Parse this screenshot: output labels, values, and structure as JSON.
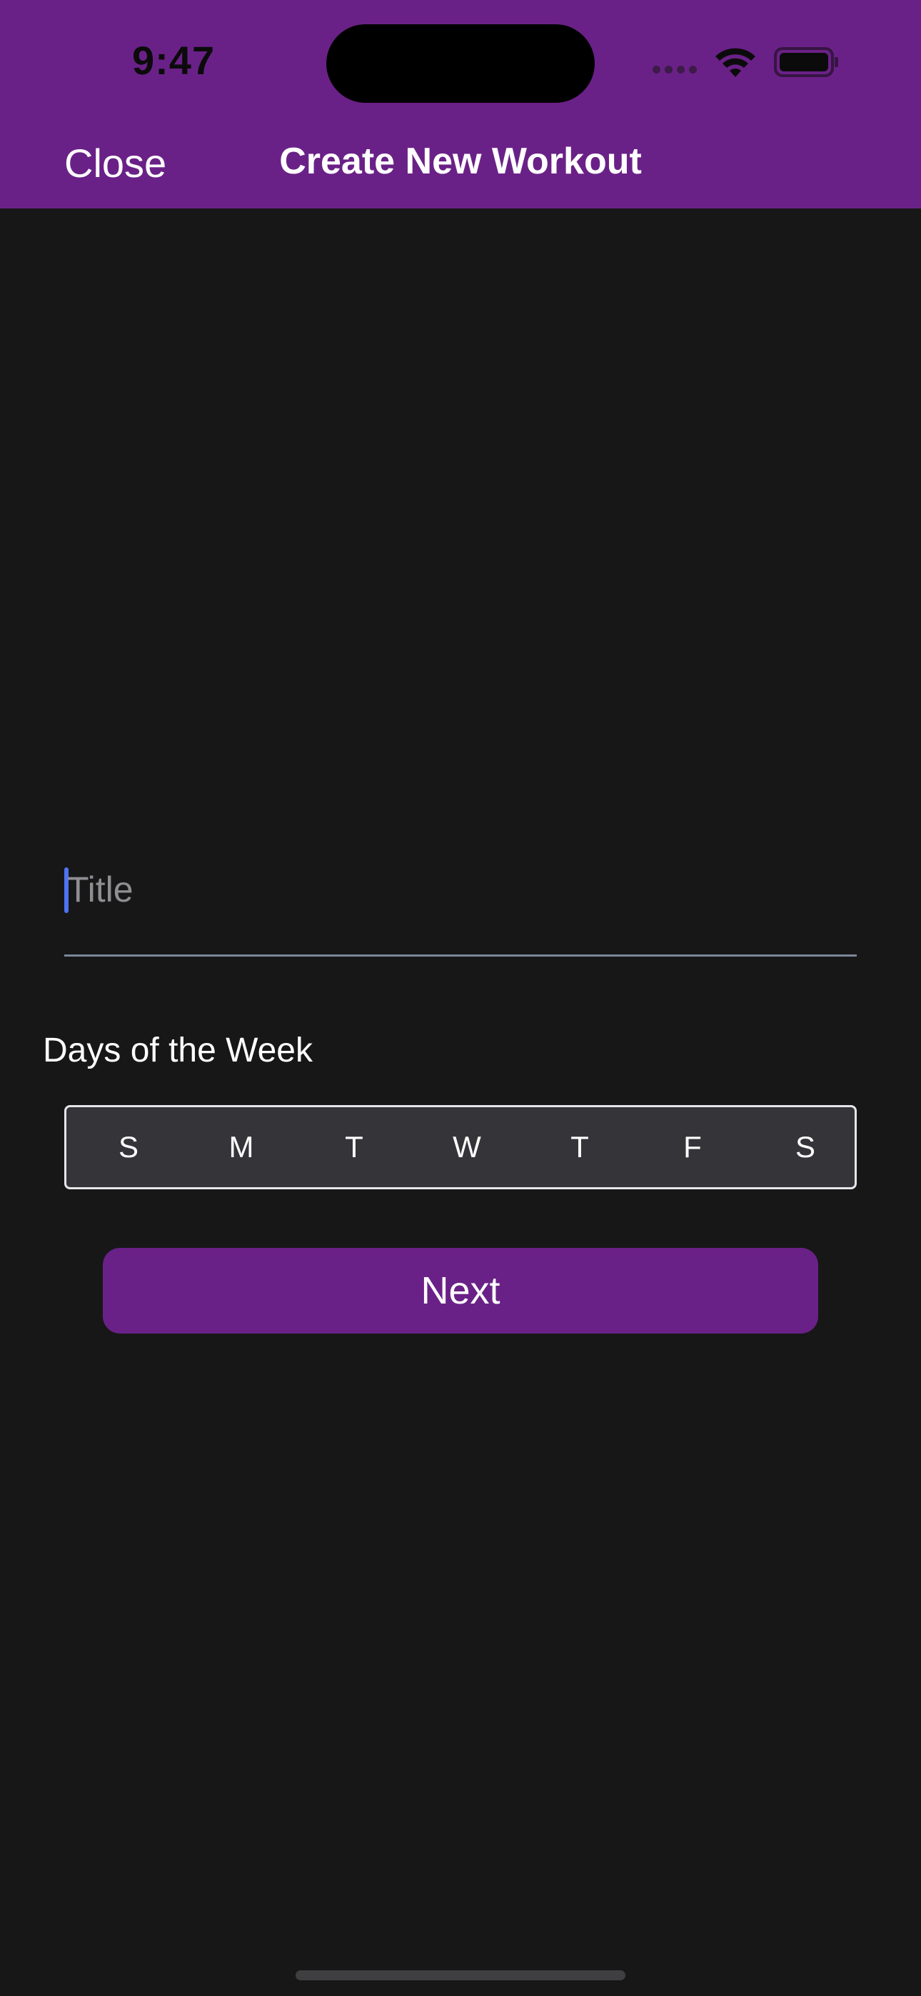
{
  "status_bar": {
    "time": "9:47"
  },
  "nav": {
    "close_label": "Close",
    "title": "Create New Workout"
  },
  "form": {
    "title_placeholder": "Title",
    "title_value": "",
    "days_label": "Days of the Week",
    "days": [
      "S",
      "M",
      "T",
      "W",
      "T",
      "F",
      "S"
    ],
    "next_label": "Next"
  },
  "colors": {
    "accent": "#6a2187",
    "background": "#171717",
    "segment_bg": "#353539",
    "cursor": "#4d73f2"
  },
  "icons": {
    "wifi": "wifi-icon",
    "battery": "battery-icon",
    "signal": "cellular-signal-icon"
  }
}
